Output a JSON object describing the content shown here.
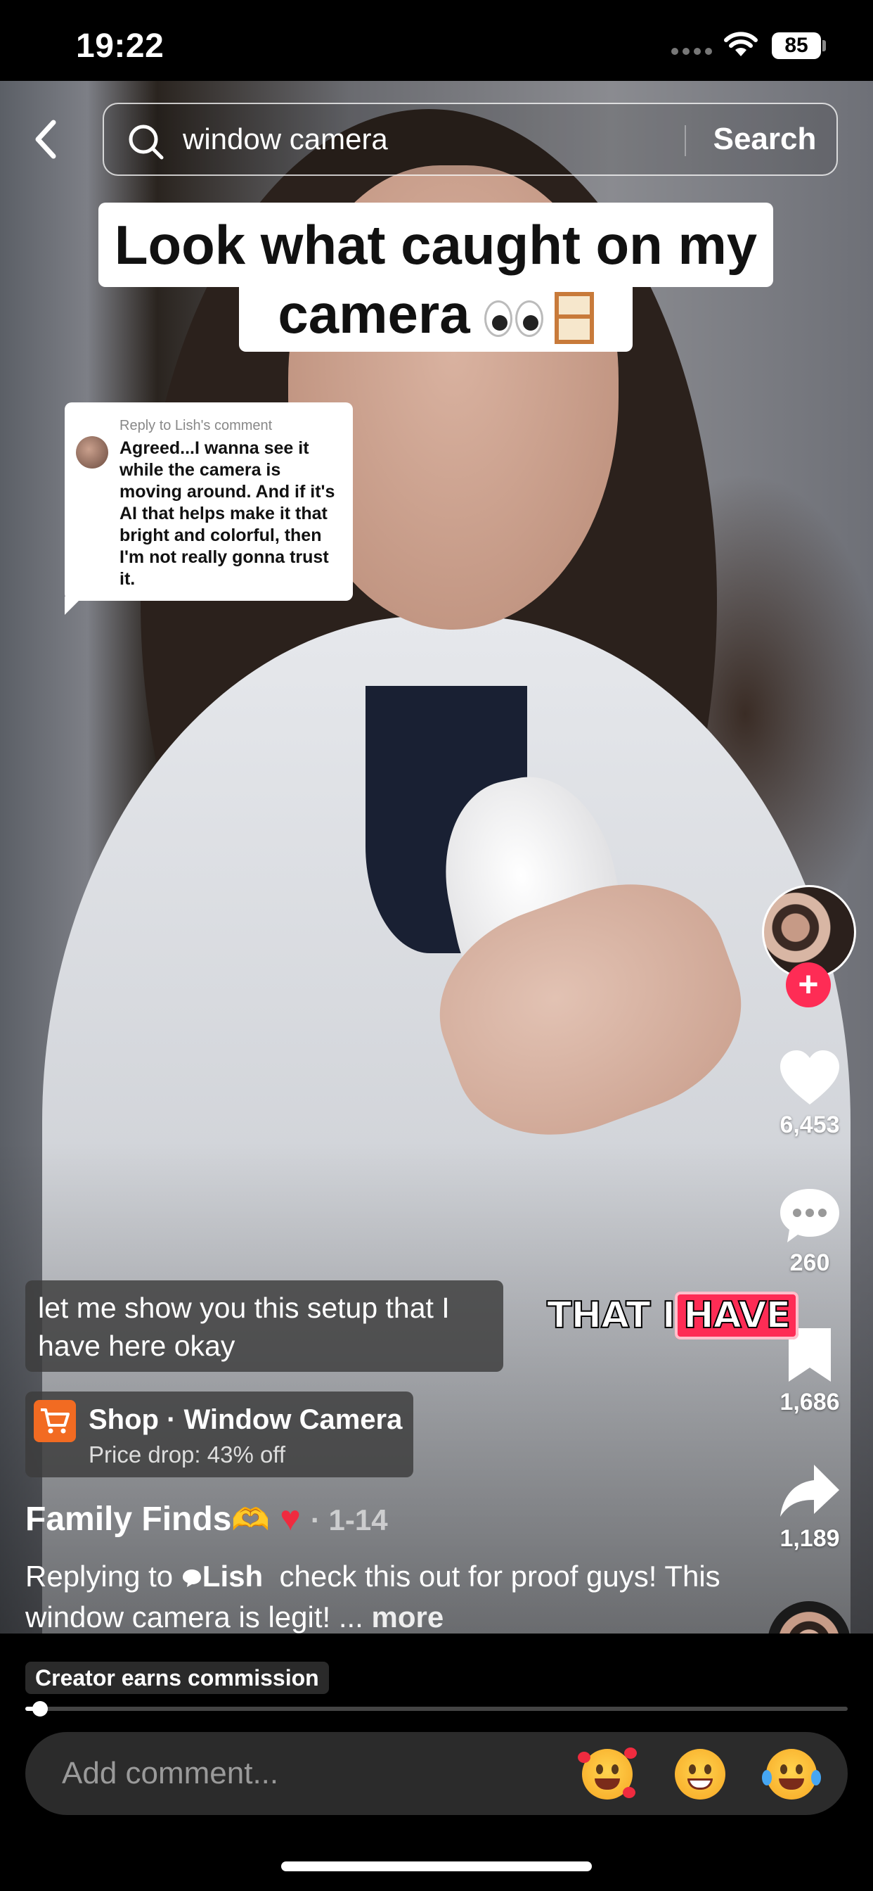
{
  "status_bar": {
    "time": "19:22",
    "battery": "85"
  },
  "search": {
    "query": "window camera",
    "button_label": "Search"
  },
  "overlay_title": {
    "line1": "Look what caught on my",
    "line2": "camera"
  },
  "reply_card": {
    "label": "Reply to Lish's comment",
    "text": "Agreed...I wanna see it while the camera is moving around. And if it's AI that helps make it that bright and colorful, then I'm not really gonna trust it."
  },
  "actions": {
    "likes": "6,453",
    "comments": "260",
    "saves": "1,686",
    "shares": "1,189"
  },
  "subtitle": "let me show you this setup that I have here okay",
  "burned_caption": {
    "word1": "THAT I",
    "word2": "HAVE"
  },
  "shop": {
    "title": "Shop · Window Camera",
    "subtitle": "Price drop: 43% off"
  },
  "post": {
    "creator": "Family Finds",
    "date": "· 1-14",
    "reply_prefix": "Replying to",
    "mention": "Lish",
    "description": "check this out for proof guys! This window camera is legit! ...",
    "more": "more"
  },
  "commission_badge": "Creator earns commission",
  "playback": {
    "progress_fraction": 0.012
  },
  "comment_bar": {
    "placeholder": "Add comment..."
  },
  "colors": {
    "accent": "#fe2c55",
    "shop": "#f26b22"
  }
}
